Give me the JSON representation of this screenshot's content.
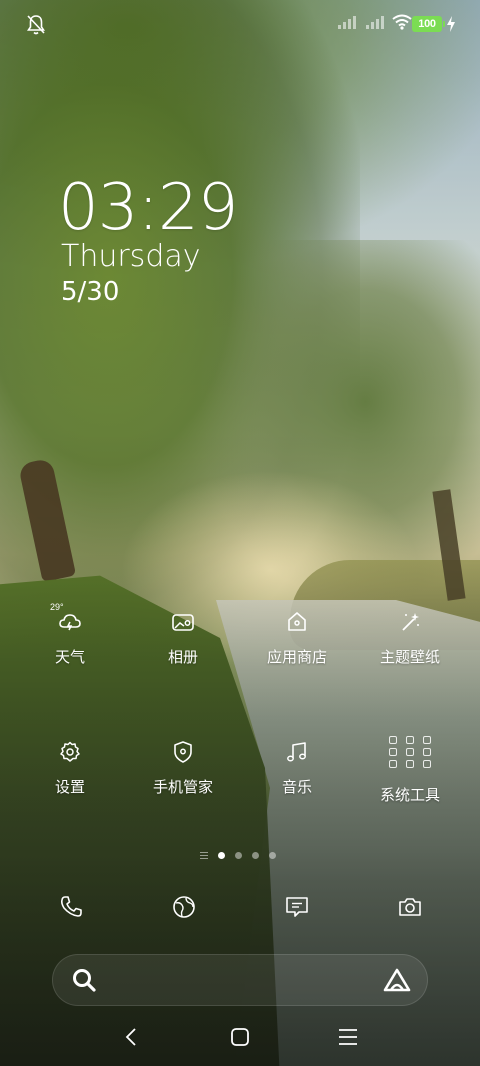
{
  "status_bar": {
    "battery": "100",
    "icons": [
      "bell-muted-icon",
      "signal-icon",
      "signal-icon",
      "wifi-icon",
      "battery-icon",
      "charging-icon"
    ]
  },
  "lock_clock": {
    "time": "03:29",
    "weekday": "Thursday",
    "date": "5/30"
  },
  "apps": [
    {
      "label": "天气",
      "icon": "weather-icon",
      "temp": "29°"
    },
    {
      "label": "相册",
      "icon": "gallery-icon"
    },
    {
      "label": "应用商店",
      "icon": "app-store-icon"
    },
    {
      "label": "主题壁纸",
      "icon": "theme-wand-icon"
    },
    {
      "label": "设置",
      "icon": "gear-icon"
    },
    {
      "label": "手机管家",
      "icon": "shield-icon"
    },
    {
      "label": "音乐",
      "icon": "music-note-icon"
    },
    {
      "label": "系统工具",
      "icon": "tools-folder-icon"
    }
  ],
  "page_indicator": {
    "pages": 4,
    "active": 1
  },
  "dock": [
    "phone-icon",
    "browser-icon",
    "messages-icon",
    "camera-icon"
  ],
  "search_bar": {
    "icons": [
      "search-icon",
      "assistant-icon"
    ]
  },
  "nav_bar": [
    "back-icon",
    "home-icon",
    "menu-icon"
  ]
}
